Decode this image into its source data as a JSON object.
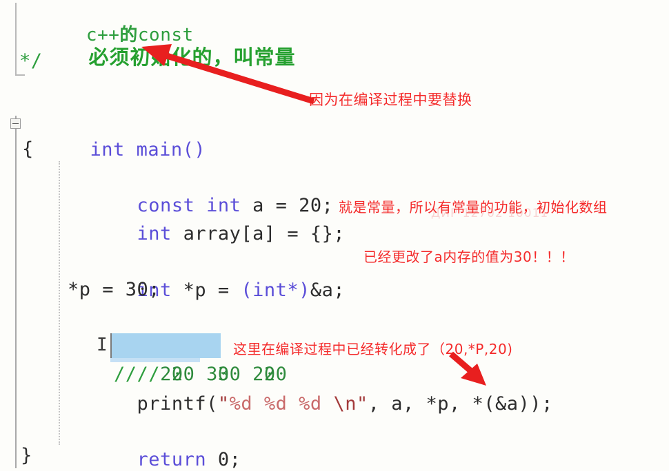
{
  "editor": {
    "background_color": "#fdfdfa",
    "comment_color": "#2e9e3e",
    "keyword_color": "#5b4ed8",
    "string_color": "#a33a3a",
    "annotation_color": "#f42b2b",
    "selection_color": "#a8d4f0"
  },
  "comment_block": {
    "line1_pre": "c++",
    "line1_cn": "的",
    "line1_post": "const",
    "line2": "必须初始化的，叫常量",
    "line3": "*/"
  },
  "code": {
    "main_signature": "int main()",
    "brace_open": "{",
    "const_decl": "const int a = 20;",
    "const_kw": "const int",
    "const_rest": " a = 20;",
    "array_kw": "int",
    "array_rest": " array[a] = {};",
    "ptr_kw": "int",
    "ptr_mid": " *p = ",
    "ptr_cast": "(int*)",
    "ptr_tail": "&a;",
    "ptr_assign": "*p = 30;",
    "comment_slashes": "// ",
    "comment_values": "20  30  20",
    "printf_name": "printf(",
    "printf_quote_open": "\"",
    "printf_fmt1": "%d",
    "printf_fmt2": "%d",
    "printf_fmt3": "%d",
    "printf_escape": "\\n",
    "printf_quote_close": "\"",
    "printf_args": ", a, *p, *(&a));",
    "return_kw": "return",
    "return_val": " 0;",
    "brace_close": "}"
  },
  "annotations": {
    "compile_replace": "因为在编译过程中要替换",
    "constant_function": "就是常量，所以有常量的功能，初始化数组",
    "memory_changed": "已经更改了a内存的值为30！！！",
    "compile_converted": "这里在编译过程中已经转化成了（20,*P,20)",
    "watermark": "ДИР 12702 10011"
  }
}
